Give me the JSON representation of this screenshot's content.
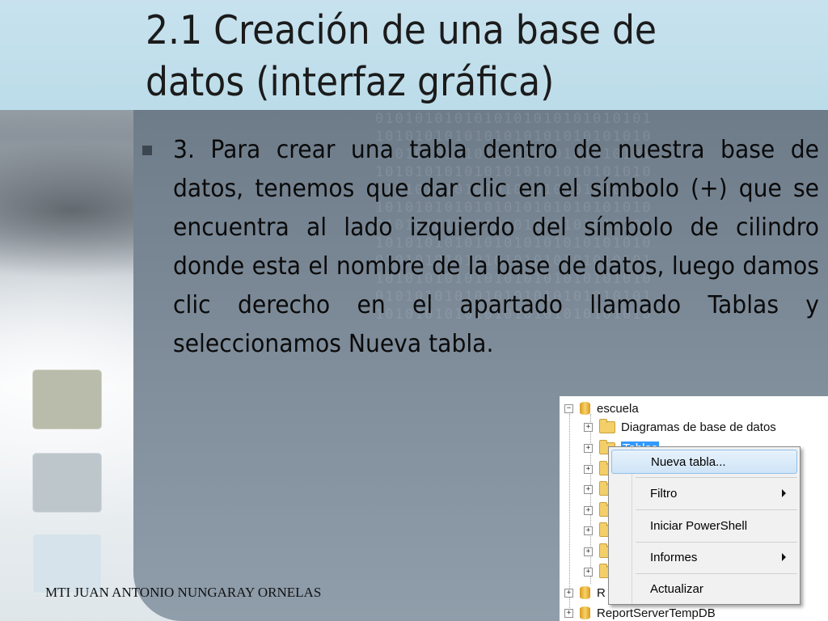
{
  "slide": {
    "title": "2.1 Creación de una base de datos (interfaz gráfica)",
    "bullet_text": "3. Para crear una tabla dentro de nuestra base de datos, tenemos que dar clic en el símbolo (+) que se encuentra al lado izquierdo del símbolo de cilindro donde esta el nombre de la base de datos, luego damos clic derecho en el apartado llamado Tablas y seleccionamos Nueva tabla.",
    "footer": "MTI JUAN ANTONIO NUNGARAY ORNELAS"
  },
  "tree": {
    "database": "escuela",
    "folders": [
      "Diagramas de base de datos",
      "Tablas"
    ],
    "partial_bottom": [
      "R",
      "ReportServerTempDB"
    ],
    "collapse_glyph": "−",
    "expand_glyph": "+"
  },
  "context_menu": {
    "items": [
      {
        "label": "Nueva tabla...",
        "submenu": false,
        "highlighted": true
      },
      {
        "label": "Filtro",
        "submenu": true,
        "highlighted": false
      },
      {
        "label": "Iniciar PowerShell",
        "submenu": false,
        "highlighted": false
      },
      {
        "label": "Informes",
        "submenu": true,
        "highlighted": false
      },
      {
        "label": "Actualizar",
        "submenu": false,
        "highlighted": false
      }
    ]
  },
  "colors": {
    "title_band": "#c7e2ee",
    "content_panel": "#7e8c9a",
    "selection": "#3399ff"
  }
}
